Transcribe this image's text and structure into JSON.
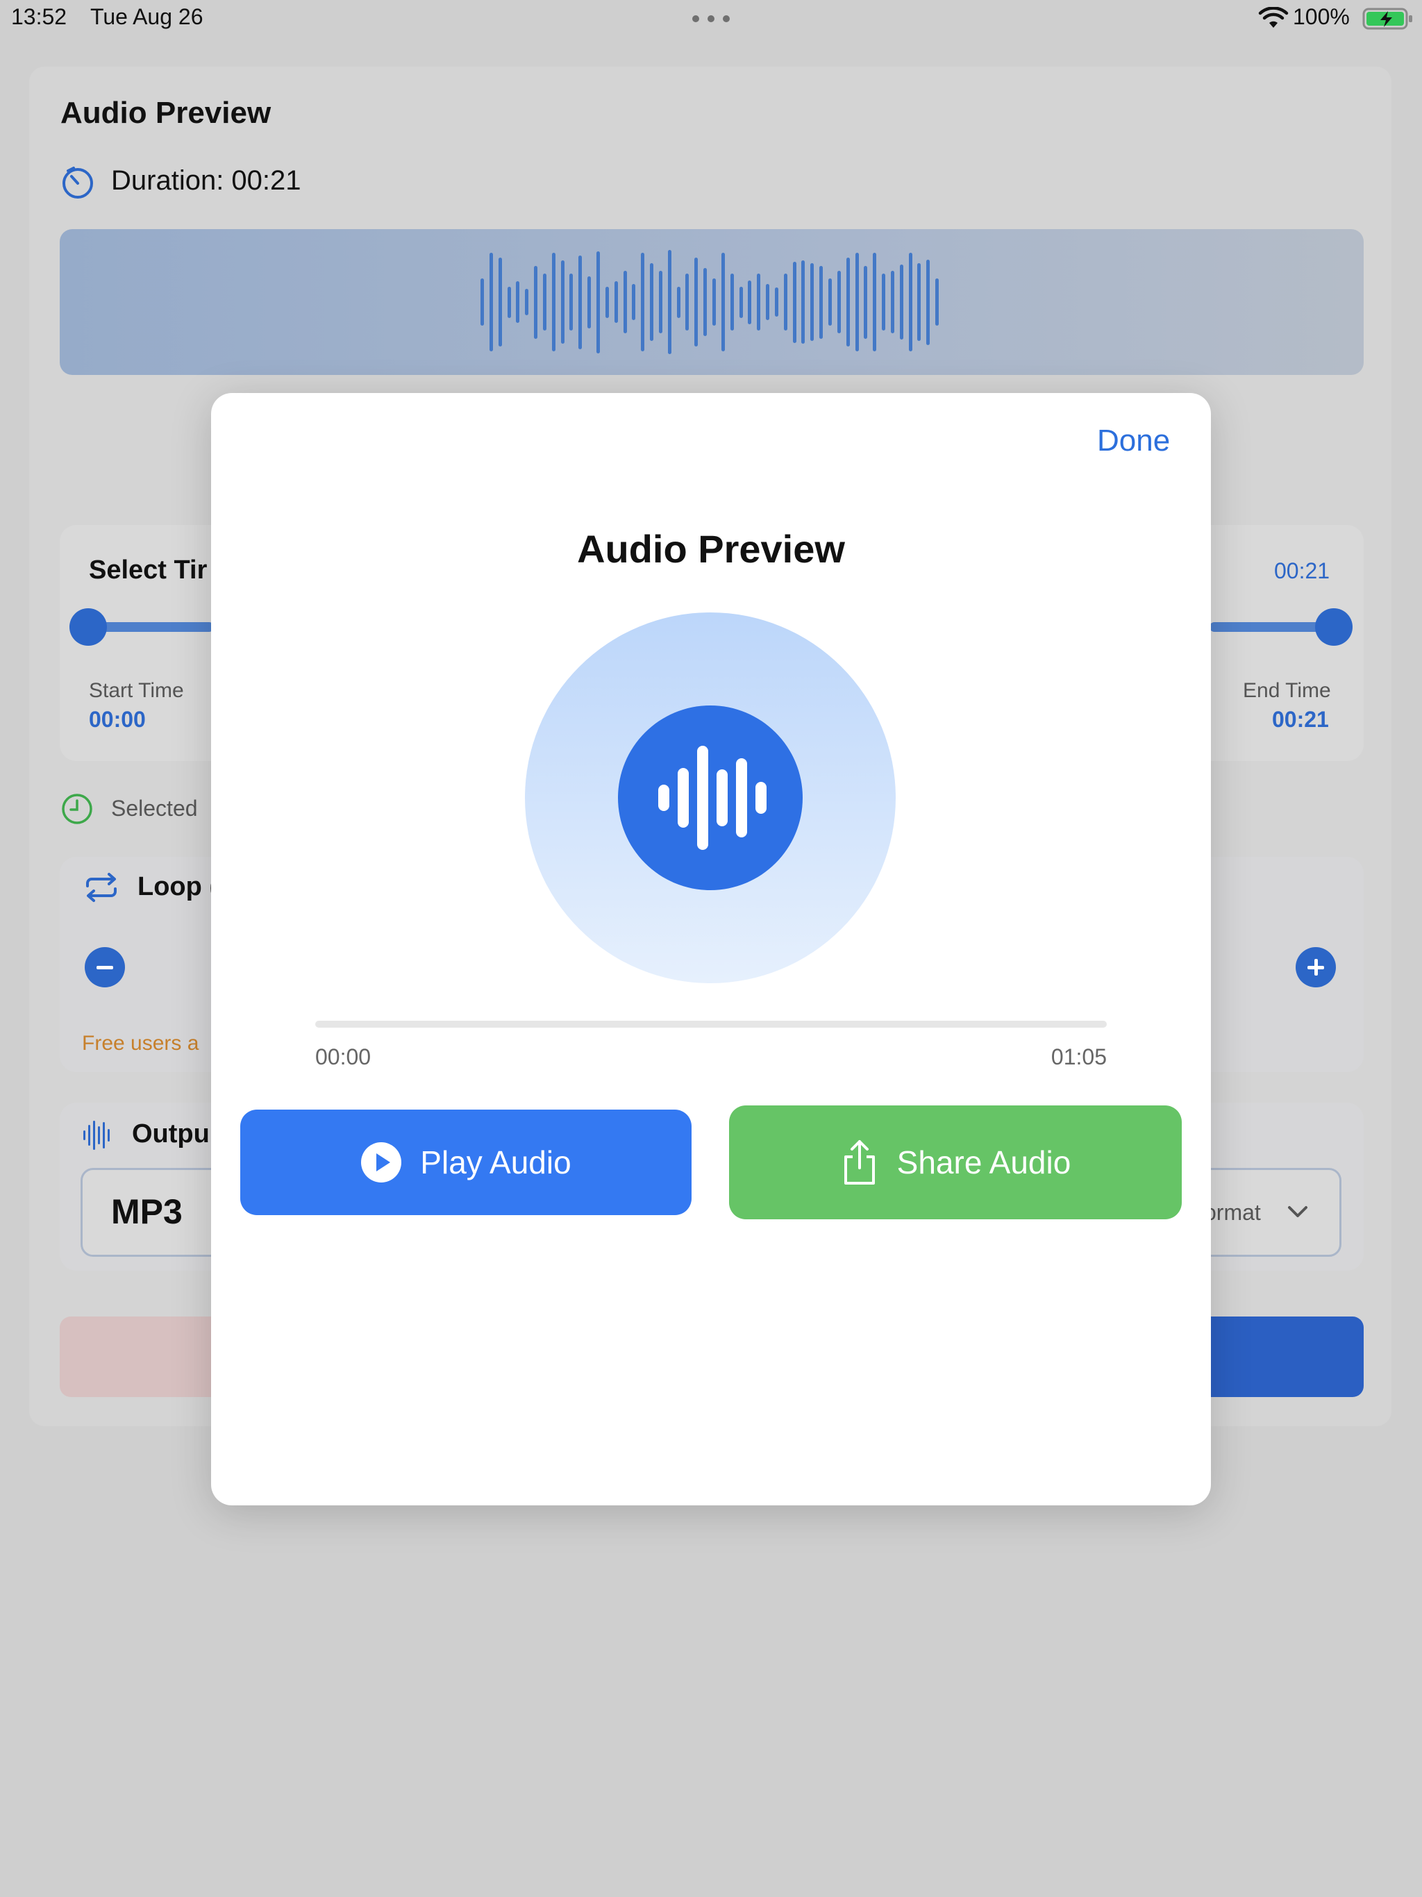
{
  "status_bar": {
    "time": "13:52",
    "date": "Tue Aug 26",
    "battery_percent": "100%",
    "icons": [
      "wifi-icon",
      "battery-charging-icon",
      "multitask-dots-icon"
    ]
  },
  "background": {
    "title": "Audio Preview",
    "duration_text": "Duration: 00:21",
    "range_section": {
      "label": "Select Tir",
      "right_value": "00:21",
      "start_label": "Start Time",
      "start_value": "00:00",
      "end_label": "End Time",
      "end_value": "00:21"
    },
    "selected_text": "Selected",
    "loop_label": "Loop (",
    "free_users_text": "Free users a",
    "output_label": "Outpu",
    "format_value": "MP3",
    "format_placeholder": "ormat"
  },
  "modal": {
    "done_label": "Done",
    "title": "Audio Preview",
    "progress": {
      "current": "00:00",
      "total": "01:05",
      "fraction": 0
    },
    "play_button_label": "Play Audio",
    "share_button_label": "Share Audio"
  },
  "colors": {
    "accent_blue": "#3479f2",
    "share_green": "#66c466",
    "link_blue": "#2c6fdc",
    "warning_orange": "#c7802c"
  }
}
